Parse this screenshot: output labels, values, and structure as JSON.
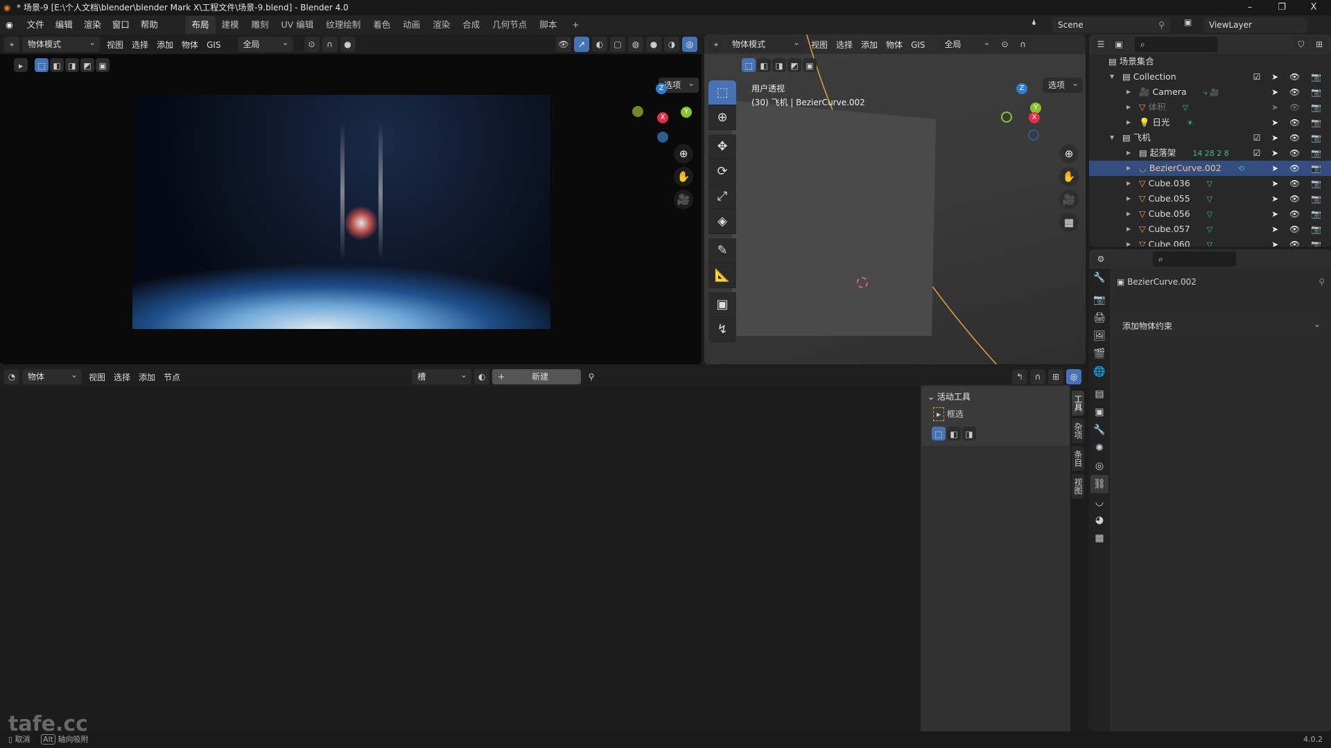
{
  "window": {
    "title": "* 场景-9 [E:\\个人文档\\blender\\blender Mark X\\工程文件\\场景-9.blend] - Blender 4.0",
    "minimize": "–",
    "maximize": "❐",
    "close": "X"
  },
  "menu": [
    "文件",
    "编辑",
    "渲染",
    "窗口",
    "帮助"
  ],
  "workspaces": [
    "布局",
    "建模",
    "雕刻",
    "UV 编辑",
    "纹理绘制",
    "着色",
    "动画",
    "渲染",
    "合成",
    "几何节点",
    "脚本"
  ],
  "workspace_add": "+",
  "scene": {
    "name": "Scene",
    "view_layer": "ViewLayer"
  },
  "viewport_left": {
    "mode": "物体模式",
    "menus": [
      "视图",
      "选择",
      "添加",
      "物体",
      "GIS"
    ],
    "orientation": "全局",
    "options": "选项"
  },
  "viewport_right": {
    "mode": "物体模式",
    "menus": [
      "视图",
      "选择",
      "添加",
      "物体",
      "GIS"
    ],
    "orientation": "全局",
    "options": "选项",
    "view_name": "用户透视",
    "object_info": "(30) 飞机 | BezierCurve.002"
  },
  "gizmo": {
    "z": "Z",
    "y": "Y",
    "x": "X"
  },
  "outliner": {
    "root": "场景集合",
    "rows": [
      {
        "name": "Collection",
        "level": 0,
        "type": "collection",
        "expanded": true,
        "checkbox": true
      },
      {
        "name": "Camera",
        "level": 1,
        "type": "camera",
        "extra": "⤷ 🎥"
      },
      {
        "name": "体积",
        "level": 1,
        "type": "mesh",
        "dim": true,
        "extra": "▽"
      },
      {
        "name": "日光",
        "level": 1,
        "type": "light",
        "extra": "☀"
      },
      {
        "name": "飞机",
        "level": 0,
        "type": "collection",
        "expanded": true,
        "checkbox": true
      },
      {
        "name": "起落架",
        "level": 1,
        "type": "collection",
        "checkbox": true,
        "extra": "14 28 2 8"
      },
      {
        "name": "BezierCurve.002",
        "level": 1,
        "type": "curve",
        "selected": true,
        "extra": "⟲"
      },
      {
        "name": "Cube.036",
        "level": 1,
        "type": "mesh",
        "extra": "▽"
      },
      {
        "name": "Cube.055",
        "level": 1,
        "type": "mesh",
        "extra": "▽"
      },
      {
        "name": "Cube.056",
        "level": 1,
        "type": "mesh",
        "extra": "▽"
      },
      {
        "name": "Cube.057",
        "level": 1,
        "type": "mesh",
        "extra": "▽"
      },
      {
        "name": "Cube.060",
        "level": 1,
        "type": "mesh",
        "extra": "▽"
      }
    ]
  },
  "properties": {
    "object_name": "BezierCurve.002",
    "add_constraint": "添加物体约束",
    "tabs": [
      "tool",
      "render",
      "output",
      "view-layer",
      "scene",
      "world",
      "collection",
      "object",
      "modifier",
      "particles",
      "physics",
      "constraints",
      "data",
      "material",
      "texture"
    ],
    "active_tab": "constraints"
  },
  "node_editor": {
    "editor_type": "物体",
    "menus": [
      "视图",
      "选择",
      "添加",
      "节点"
    ],
    "slot": "槽",
    "new_label": "新建",
    "new_plus": "+"
  },
  "sidebar": {
    "panel_title": "活动工具",
    "tool_name": "框选",
    "tabs": [
      "工具",
      "杂项",
      "条目",
      "视图"
    ]
  },
  "status": {
    "cancel": "取消",
    "alt_key": "Alt",
    "axis_snap": "轴向吸附",
    "version": "4.0.2"
  },
  "watermark": "tafe.cc",
  "colors": {
    "accent": "#4772b3",
    "selected_row": "#334d80",
    "curve": "#e8a040"
  }
}
